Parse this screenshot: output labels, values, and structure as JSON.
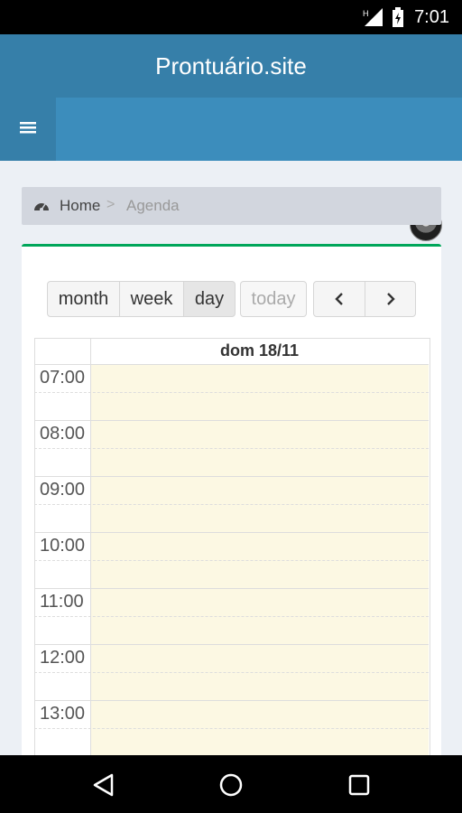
{
  "status": {
    "time": "7:01"
  },
  "app": {
    "title": "Prontuário.site"
  },
  "breadcrumb": {
    "home": "Home",
    "separator": ">",
    "current": "Agenda"
  },
  "calendar": {
    "views": [
      "month",
      "week",
      "day"
    ],
    "active_view": "day",
    "today": "today",
    "day_header": "dom 18/11",
    "hours": [
      "07:00",
      "08:00",
      "09:00",
      "10:00",
      "11:00",
      "12:00",
      "13:00"
    ]
  },
  "colors": {
    "header": "#367fa9",
    "navbar": "#3c8dbc",
    "box_border": "#00a65a",
    "today_bg": "#fcf8e3"
  }
}
